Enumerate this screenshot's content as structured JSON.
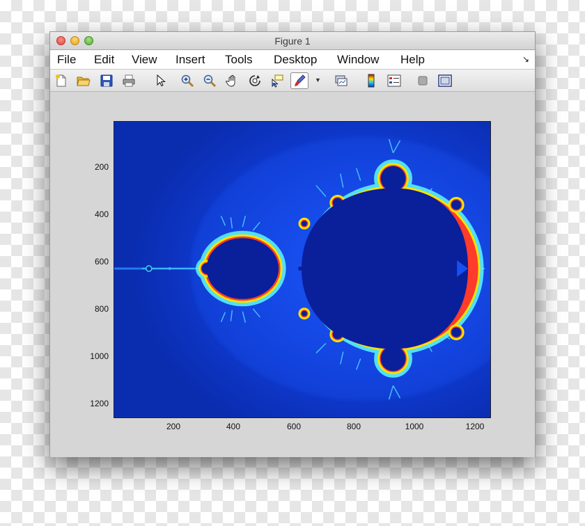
{
  "window": {
    "title": "Figure 1"
  },
  "menu": [
    "File",
    "Edit",
    "View",
    "Insert",
    "Tools",
    "Desktop",
    "Window",
    "Help"
  ],
  "menu_corner_icon": "dock-arrow-icon",
  "toolbar": [
    "new-figure-icon",
    "open-icon",
    "save-icon",
    "print-icon",
    "pointer-icon",
    "zoom-in-icon",
    "zoom-out-icon",
    "pan-icon",
    "rotate-3d-icon",
    "data-cursor-icon",
    "brush-icon",
    "link-plot-icon",
    "colorbar-icon",
    "legend-icon",
    "hide-tools-icon",
    "show-tools-icon"
  ],
  "axes": {
    "x_ticks": [
      "200",
      "400",
      "600",
      "800",
      "1000",
      "1200"
    ],
    "y_ticks": [
      "200",
      "400",
      "600",
      "800",
      "1000",
      "1200"
    ],
    "x_range": [
      0,
      1250
    ],
    "y_range": [
      0,
      1250
    ],
    "colormap": "jet",
    "content": "Mandelbrot set"
  }
}
